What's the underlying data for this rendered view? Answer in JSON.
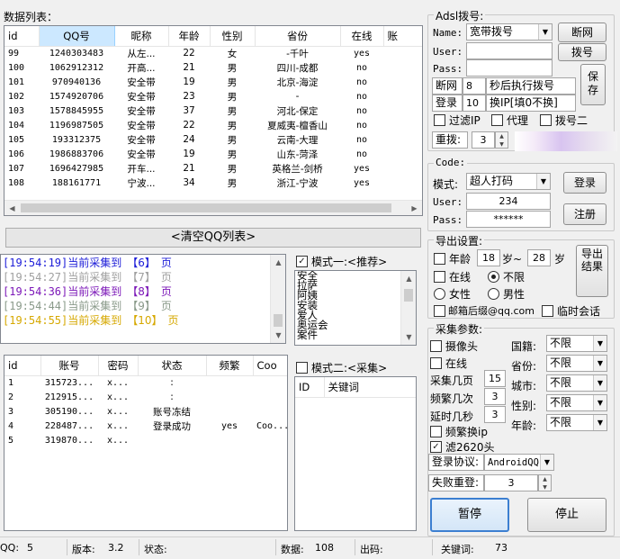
{
  "data_list": {
    "title": "数据列表：",
    "columns": [
      "id",
      "QQ号",
      "昵称",
      "年龄",
      "性别",
      "省份",
      "在线",
      "账"
    ],
    "rows": [
      [
        "99",
        "1240303483",
        "从左...",
        "22",
        "女",
        "-千叶",
        "yes"
      ],
      [
        "100",
        "1062912312",
        "开高...",
        "21",
        "男",
        "四川-成都",
        "no"
      ],
      [
        "101",
        "970940136",
        "安全带",
        "19",
        "男",
        "北京-海淀",
        "no"
      ],
      [
        "102",
        "1574920706",
        "安全带",
        "23",
        "男",
        "-",
        "no"
      ],
      [
        "103",
        "1578845955",
        "安全带",
        "37",
        "男",
        "河北-保定",
        "no"
      ],
      [
        "104",
        "1196987505",
        "安全带",
        "22",
        "男",
        "夏威夷-檀香山",
        "no"
      ],
      [
        "105",
        "193312375",
        "安全带",
        "24",
        "男",
        "云南-大理",
        "no"
      ],
      [
        "106",
        "1986883706",
        "安全带",
        "19",
        "男",
        "山东-菏泽",
        "no"
      ],
      [
        "107",
        "1696427985",
        "开车...",
        "21",
        "男",
        "英格兰-剑桥",
        "yes"
      ],
      [
        "108",
        "188161771",
        "宁波...",
        "34",
        "男",
        "浙江-宁波",
        "yes"
      ]
    ]
  },
  "clear_button": "<清空QQ列表>",
  "log": {
    "lines": [
      {
        "time": "[19:54:19]",
        "text": "当前采集到",
        "num": "【6】",
        "unit": "页",
        "color": "#1c1cd8"
      },
      {
        "time": "[19:54:27]",
        "text": "当前采集到",
        "num": "【7】",
        "unit": "页",
        "color": "#a0a0a0"
      },
      {
        "time": "[19:54:36]",
        "text": "当前采集到",
        "num": "【8】",
        "unit": "页",
        "color": "#7c18b8"
      },
      {
        "time": "[19:54:44]",
        "text": "当前采集到",
        "num": "【9】",
        "unit": "页",
        "color": "#8a9a8a"
      },
      {
        "time": "[19:54:55]",
        "text": "当前采集到",
        "num": "【10】",
        "unit": "页",
        "color": "#d6a800"
      }
    ]
  },
  "mode1": {
    "label": "模式一:<推荐>",
    "checked": true,
    "items": [
      "安全",
      "拉萨",
      "阿姨",
      "安装",
      "爱人",
      "奥运会",
      "案件"
    ]
  },
  "account_list": {
    "columns": [
      "id",
      "账号",
      "密码",
      "状态",
      "频繁",
      "Coo"
    ],
    "rows": [
      [
        "1",
        "315723...",
        "x...",
        ":",
        "",
        ""
      ],
      [
        "2",
        "212915...",
        "x...",
        ":",
        "",
        ""
      ],
      [
        "3",
        "305190...",
        "x...",
        "账号冻结",
        "",
        ""
      ],
      [
        "4",
        "228487...",
        "x...",
        "登录成功",
        "yes",
        "Coo..."
      ],
      [
        "5",
        "319870...",
        "x...",
        "",
        "",
        ""
      ]
    ]
  },
  "mode2": {
    "label": "模式二:<采集>",
    "checked": false,
    "columns": [
      "ID",
      "关键词"
    ]
  },
  "adsl": {
    "title": "Adsl拨号:",
    "name_label": "Name:",
    "name_value": "宽带拨号",
    "user_label": "User:",
    "pass_label": "Pass:",
    "disconnect_btn": "断网",
    "dial_btn": "拨号",
    "save_btn": "保存",
    "break_label": "断网",
    "break_value": "8",
    "break_suffix": "秒后执行拨号",
    "login_label": "登录",
    "login_value": "10",
    "login_suffix": "换IP[填0不换]",
    "filter_ip": "过滤IP",
    "proxy": "代理",
    "dial2": "拨号二",
    "redial_label": "重拨:",
    "redial_value": "3"
  },
  "code": {
    "title": "Code:",
    "mode_label": "模式:",
    "mode_value": "超人打码",
    "user_label": "User:",
    "user_value": "234",
    "pass_label": "Pass:",
    "pass_value": "******",
    "login_btn": "登录",
    "register_btn": "注册"
  },
  "export": {
    "title": "导出设置:",
    "age_label": "年龄",
    "age_from": "18",
    "age_mid": "岁~",
    "age_to": "28",
    "age_unit": "岁",
    "online": "在线",
    "unlimited": "不限",
    "female": "女性",
    "male": "男性",
    "email_suffix": "邮箱后缀@qq.com",
    "temp_chat": "临时会话",
    "export_btn": "导出结果"
  },
  "collect": {
    "title": "采集参数:",
    "camera": "摄像头",
    "online": "在线",
    "pages_label": "采集几页",
    "pages_value": "15",
    "freq_label": "频繁几次",
    "freq_value": "3",
    "delay_label": "延时几秒",
    "delay_value": "3",
    "freq_ip": "频繁换ip",
    "filter2620": "滤2620头",
    "filter2620_checked": true,
    "nationality_label": "国籍:",
    "province_label": "省份:",
    "city_label": "城市:",
    "gender_label": "性别:",
    "age_label": "年龄:",
    "unlimited": "不限",
    "protocol_label": "登录协议:",
    "protocol_value": "AndroidQQ",
    "retry_label": "失败重登:",
    "retry_value": "3",
    "pause_btn": "暂停",
    "stop_btn": "停止"
  },
  "status": {
    "qq_label": "QQ:",
    "qq_value": "5",
    "version_label": "版本:",
    "version_value": "3.2",
    "state_label": "状态:",
    "data_label": "数据:",
    "data_value": "108",
    "output_label": "出码:",
    "keyword_label": "关键词:",
    "keyword_value": "73"
  }
}
